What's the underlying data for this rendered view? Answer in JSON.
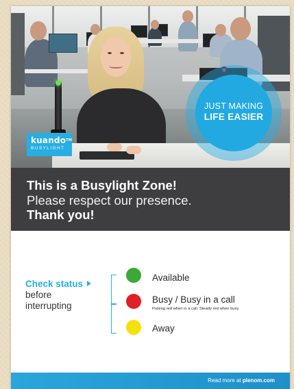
{
  "logo": {
    "brand": "kuando",
    "trademark": "TM",
    "subtitle": "BUSYLIGHT"
  },
  "tagline": {
    "line1": "JUST MAKING",
    "line2": "LIFE EASIER"
  },
  "banner": {
    "line1": "This is a Busylight Zone!",
    "line2": "Please respect our presence.",
    "line3": "Thank you!"
  },
  "check": {
    "title": "Check status",
    "line2": "before",
    "line3": "interrupting"
  },
  "statuses": [
    {
      "label": "Available",
      "color": "#3aa935"
    },
    {
      "label": "Busy / Busy in a call",
      "note": "Pulsing red when in a call. Steady red when busy.",
      "color": "#e02027"
    },
    {
      "label": "Away",
      "color": "#f4e10c"
    }
  ],
  "colors": {
    "accent": "#27aee3",
    "banner": "#3e3e41"
  },
  "footer": {
    "prefix": "Read more at ",
    "site": "plenom.com"
  }
}
